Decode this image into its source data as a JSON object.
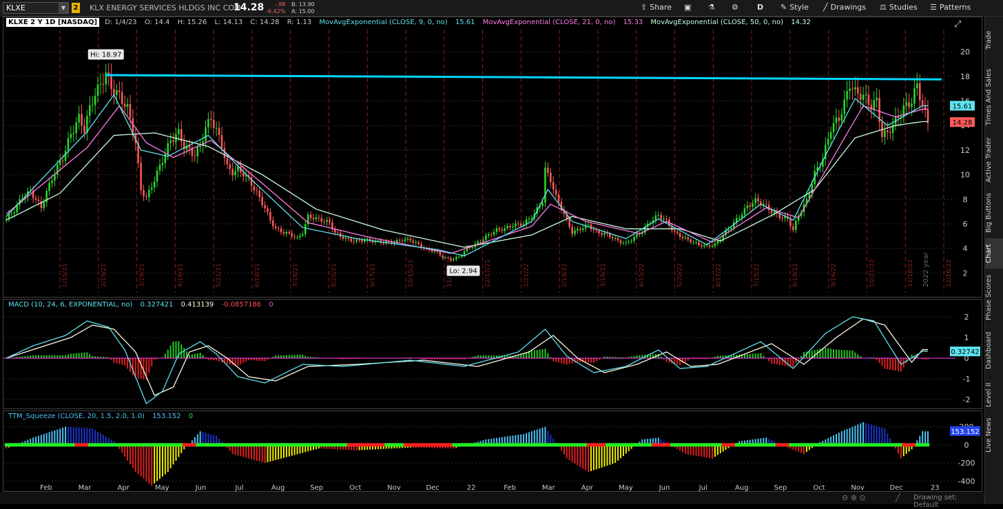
{
  "header": {
    "symbol": "KLXE",
    "link_group": "2",
    "company": "KLX ENERGY SERVICES HLDGS INC COM",
    "last": "14.28",
    "change": "-.98",
    "change_pct": "-6.42%",
    "bid": "B: 13.90",
    "ask": "A: 15.00",
    "share_label": "Share",
    "period_label": "D",
    "style_label": "Style",
    "drawings_label": "Drawings",
    "studies_label": "Studies",
    "patterns_label": "Patterns"
  },
  "price_legend": {
    "title": "KLXE 2 Y 1D [NASDAQ]",
    "date": "D: 1/4/23",
    "open": "O: 14.4",
    "high": "H: 15.26",
    "low": "L: 14.13",
    "close": "C: 14.28",
    "range": "R: 1.13",
    "ema9_label": "MovAvgExponential (CLOSE, 9, 0, no)",
    "ema9_val": "15.61",
    "ema21_label": "MovAvgExponential (CLOSE, 21, 0, no)",
    "ema21_val": "15.33",
    "ema50_label": "MovAvgExponential (CLOSE, 50, 0, no)",
    "ema50_val": "14.32"
  },
  "macd_legend": {
    "label": "MACD (10, 24, 6, EXPONENTIAL, no)",
    "value": "0.327421",
    "avg": "0.413139",
    "diff": "-0.0857186",
    "zero": "0"
  },
  "ttm_legend": {
    "label": "TTM_Squeeze (CLOSE, 20, 1.5, 2.0, 1.0)",
    "value": "153.152",
    "zero": "0"
  },
  "right_tabs": [
    "Trade",
    "Times And Sales",
    "Active Trader",
    "Big Buttons",
    "Chart",
    "Phase Scores",
    "Dashboard",
    "Level II",
    "Live News"
  ],
  "footer": {
    "drawing_set": "Drawing set: Default"
  },
  "colors": {
    "background": "#000000",
    "up_candle": "#2bd92b",
    "down_candle": "#ff5a5a",
    "ema9": "#5fe3f0",
    "ema21": "#ff7ee8",
    "ema50": "#c8ffe0",
    "resistance": "#00d8ff",
    "macd_line": "#5fe3f0",
    "macd_avg": "#fffbe0",
    "macd_zero": "#ff40ff",
    "ttm_up_strong": "#4fc3f7",
    "ttm_up_weak": "#1a33cc",
    "ttm_down_strong": "#e02020",
    "ttm_down_weak": "#f0f000",
    "squeeze_on": "#ff2020",
    "squeeze_off": "#22ee22"
  },
  "chart_data": [
    {
      "type": "candlestick",
      "title": "KLXE 2 Y 1D [NASDAQ]",
      "x_axis_months": [
        "Feb",
        "Mar",
        "Apr",
        "May",
        "Jun",
        "Jul",
        "Aug",
        "Sep",
        "Oct",
        "Nov",
        "Dec",
        "22",
        "Feb",
        "Mar",
        "Apr",
        "May",
        "Jun",
        "Jul",
        "Aug",
        "Sep",
        "Oct",
        "Nov",
        "Dec",
        "23"
      ],
      "expiration_labels": [
        "1/15/21",
        "2/19/21",
        "3/19/21",
        "4/16/21",
        "5/21/21",
        "6/18/21",
        "7/16/21",
        "8/20/21",
        "9/17/21",
        "10/15/21",
        "11/19/21",
        "12/17/21",
        "1/21/22",
        "2/18/22",
        "3/18/22",
        "4/15/22",
        "5/20/22",
        "6/17/22",
        "7/15/22",
        "8/19/22",
        "9/16/22",
        "10/21/22",
        "11/18/22",
        "12/16/22"
      ],
      "year_marker": "2022 year",
      "y_ticks": [
        2,
        4,
        6,
        8,
        10,
        12,
        14,
        16,
        18,
        20
      ],
      "y_range": [
        0.4,
        21.8
      ],
      "hi_label": "Hi: 18.97",
      "lo_label": "Lo: 2.94",
      "resistance_line": {
        "from": 18.1,
        "to": 17.75
      },
      "price_badges": {
        "ema9": "15.61",
        "last": "14.28"
      },
      "close_approx": [
        [
          0,
          6.4
        ],
        [
          3,
          7.1
        ],
        [
          6,
          8.2
        ],
        [
          9,
          8.6
        ],
        [
          11,
          8.0
        ],
        [
          13,
          7.3
        ],
        [
          15,
          8.6
        ],
        [
          18,
          10.2
        ],
        [
          21,
          11.4
        ],
        [
          24,
          13.3
        ],
        [
          27,
          14.6
        ],
        [
          29,
          13.7
        ],
        [
          31,
          15.4
        ],
        [
          33,
          16.6
        ],
        [
          35,
          17.3
        ],
        [
          37,
          18.3
        ],
        [
          39,
          17.1
        ],
        [
          42,
          16.4
        ],
        [
          45,
          15.4
        ],
        [
          48,
          12.6
        ],
        [
          50,
          8.8
        ],
        [
          52,
          8.1
        ],
        [
          55,
          9.6
        ],
        [
          58,
          11.2
        ],
        [
          61,
          12.8
        ],
        [
          64,
          13.4
        ],
        [
          66,
          12.3
        ],
        [
          68,
          12.0
        ],
        [
          70,
          11.6
        ],
        [
          72,
          12.3
        ],
        [
          74,
          13.8
        ],
        [
          76,
          14.6
        ],
        [
          78,
          13.6
        ],
        [
          80,
          12.4
        ],
        [
          82,
          10.6
        ],
        [
          84,
          10.2
        ],
        [
          86,
          10.4
        ],
        [
          88,
          10.1
        ],
        [
          90,
          9.6
        ],
        [
          93,
          8.5
        ],
        [
          96,
          7.3
        ],
        [
          98,
          6.3
        ],
        [
          100,
          5.6
        ],
        [
          103,
          5.3
        ],
        [
          106,
          5.1
        ],
        [
          108,
          4.8
        ],
        [
          110,
          5.3
        ],
        [
          112,
          6.6
        ],
        [
          114,
          6.5
        ],
        [
          117,
          6.3
        ],
        [
          120,
          6.1
        ],
        [
          122,
          5.3
        ],
        [
          124,
          5.0
        ],
        [
          127,
          4.7
        ],
        [
          130,
          4.6
        ],
        [
          133,
          4.7
        ],
        [
          136,
          4.6
        ],
        [
          140,
          4.5
        ],
        [
          144,
          4.5
        ],
        [
          147,
          4.7
        ],
        [
          150,
          4.7
        ],
        [
          153,
          4.3
        ],
        [
          156,
          3.9
        ],
        [
          159,
          3.8
        ],
        [
          162,
          3.3
        ],
        [
          165,
          3.1
        ],
        [
          168,
          3.3
        ],
        [
          171,
          4.0
        ],
        [
          173,
          4.2
        ],
        [
          176,
          4.6
        ],
        [
          179,
          5.1
        ],
        [
          182,
          5.5
        ],
        [
          185,
          5.6
        ],
        [
          188,
          5.9
        ],
        [
          192,
          6.0
        ],
        [
          196,
          6.8
        ],
        [
          199,
          7.9
        ],
        [
          200,
          10.4
        ],
        [
          202,
          9.6
        ],
        [
          204,
          8.2
        ],
        [
          206,
          7.3
        ],
        [
          208,
          6.3
        ],
        [
          210,
          5.3
        ],
        [
          213,
          5.6
        ],
        [
          216,
          5.9
        ],
        [
          219,
          5.3
        ],
        [
          222,
          5.2
        ],
        [
          225,
          4.9
        ],
        [
          227,
          4.6
        ],
        [
          230,
          4.4
        ],
        [
          233,
          4.9
        ],
        [
          236,
          5.4
        ],
        [
          239,
          6.2
        ],
        [
          242,
          6.7
        ],
        [
          245,
          6.2
        ],
        [
          248,
          5.3
        ],
        [
          251,
          4.9
        ],
        [
          254,
          4.6
        ],
        [
          257,
          4.3
        ],
        [
          260,
          4.2
        ],
        [
          263,
          4.3
        ],
        [
          266,
          5.1
        ],
        [
          269,
          5.8
        ],
        [
          272,
          6.6
        ],
        [
          275,
          7.4
        ],
        [
          278,
          7.9
        ],
        [
          281,
          7.6
        ],
        [
          284,
          7.0
        ],
        [
          287,
          6.6
        ],
        [
          290,
          6.4
        ],
        [
          292,
          5.5
        ],
        [
          294,
          6.7
        ],
        [
          297,
          7.9
        ],
        [
          300,
          10.1
        ],
        [
          303,
          11.3
        ],
        [
          306,
          13.8
        ],
        [
          309,
          14.6
        ],
        [
          311,
          15.8
        ],
        [
          313,
          17.4
        ],
        [
          315,
          16.7
        ],
        [
          318,
          16.4
        ],
        [
          321,
          15.6
        ],
        [
          323,
          16.0
        ],
        [
          325,
          13.2
        ],
        [
          327,
          13.4
        ],
        [
          330,
          14.4
        ],
        [
          333,
          15.4
        ],
        [
          336,
          16.0
        ],
        [
          338,
          17.3
        ],
        [
          340,
          15.6
        ],
        [
          342,
          14.28
        ]
      ],
      "ema9_approx": [
        [
          0,
          6.6
        ],
        [
          30,
          13.5
        ],
        [
          40,
          16.5
        ],
        [
          50,
          12.0
        ],
        [
          60,
          11.5
        ],
        [
          75,
          13.2
        ],
        [
          90,
          9.8
        ],
        [
          110,
          5.7
        ],
        [
          130,
          4.8
        ],
        [
          160,
          3.9
        ],
        [
          170,
          3.4
        ],
        [
          195,
          6.2
        ],
        [
          201,
          8.8
        ],
        [
          210,
          6.2
        ],
        [
          230,
          4.8
        ],
        [
          242,
          6.4
        ],
        [
          260,
          4.3
        ],
        [
          280,
          7.6
        ],
        [
          292,
          6.3
        ],
        [
          305,
          12.0
        ],
        [
          315,
          16.2
        ],
        [
          327,
          14.0
        ],
        [
          340,
          15.61
        ]
      ],
      "ema21_approx": [
        [
          0,
          6.8
        ],
        [
          30,
          12.2
        ],
        [
          42,
          15.6
        ],
        [
          52,
          12.6
        ],
        [
          62,
          11.4
        ],
        [
          76,
          12.8
        ],
        [
          95,
          9.3
        ],
        [
          112,
          6.1
        ],
        [
          135,
          4.9
        ],
        [
          165,
          3.6
        ],
        [
          195,
          5.8
        ],
        [
          202,
          7.6
        ],
        [
          215,
          6.2
        ],
        [
          235,
          5.2
        ],
        [
          245,
          6.2
        ],
        [
          262,
          4.5
        ],
        [
          282,
          7.3
        ],
        [
          294,
          6.5
        ],
        [
          310,
          12.6
        ],
        [
          318,
          15.6
        ],
        [
          330,
          14.7
        ],
        [
          340,
          15.33
        ]
      ],
      "ema50_approx": [
        [
          0,
          6.3
        ],
        [
          20,
          8.5
        ],
        [
          40,
          13.2
        ],
        [
          55,
          13.4
        ],
        [
          75,
          12.3
        ],
        [
          95,
          10.0
        ],
        [
          115,
          7.2
        ],
        [
          140,
          5.5
        ],
        [
          170,
          4.1
        ],
        [
          195,
          5.1
        ],
        [
          210,
          6.6
        ],
        [
          230,
          5.6
        ],
        [
          250,
          5.6
        ],
        [
          265,
          4.6
        ],
        [
          285,
          6.8
        ],
        [
          300,
          8.8
        ],
        [
          315,
          13.0
        ],
        [
          330,
          14.0
        ],
        [
          340,
          14.32
        ]
      ]
    },
    {
      "type": "line",
      "title": "MACD (10, 24, 6, EXPONENTIAL, no)",
      "y_ticks": [
        -2,
        -1,
        0,
        1,
        2
      ],
      "y_range": [
        -2.3,
        2.3
      ],
      "value_badge": "0.32742",
      "macd_approx": [
        [
          0,
          0
        ],
        [
          10,
          0.6
        ],
        [
          22,
          1.1
        ],
        [
          30,
          1.8
        ],
        [
          38,
          1.5
        ],
        [
          44,
          0.4
        ],
        [
          52,
          -2.2
        ],
        [
          58,
          -1.6
        ],
        [
          64,
          0.2
        ],
        [
          72,
          0.8
        ],
        [
          78,
          0.2
        ],
        [
          86,
          -0.9
        ],
        [
          96,
          -1.2
        ],
        [
          110,
          -0.3
        ],
        [
          125,
          -0.4
        ],
        [
          150,
          -0.1
        ],
        [
          170,
          -0.4
        ],
        [
          190,
          0.3
        ],
        [
          200,
          1.4
        ],
        [
          208,
          0.1
        ],
        [
          218,
          -0.7
        ],
        [
          230,
          -0.4
        ],
        [
          242,
          0.4
        ],
        [
          250,
          -0.5
        ],
        [
          260,
          -0.4
        ],
        [
          280,
          0.8
        ],
        [
          292,
          -0.5
        ],
        [
          304,
          1.2
        ],
        [
          314,
          2.0
        ],
        [
          322,
          1.8
        ],
        [
          332,
          -0.3
        ],
        [
          340,
          0.33
        ]
      ],
      "avg_approx": [
        [
          0,
          0
        ],
        [
          12,
          0.5
        ],
        [
          24,
          1.0
        ],
        [
          32,
          1.6
        ],
        [
          40,
          1.4
        ],
        [
          48,
          0.3
        ],
        [
          55,
          -1.8
        ],
        [
          62,
          -1.4
        ],
        [
          68,
          0.3
        ],
        [
          75,
          0.6
        ],
        [
          82,
          0.0
        ],
        [
          90,
          -0.9
        ],
        [
          100,
          -1.1
        ],
        [
          112,
          -0.4
        ],
        [
          130,
          -0.3
        ],
        [
          155,
          -0.1
        ],
        [
          175,
          -0.4
        ],
        [
          194,
          0.3
        ],
        [
          203,
          1.1
        ],
        [
          212,
          0.0
        ],
        [
          222,
          -0.7
        ],
        [
          234,
          -0.3
        ],
        [
          245,
          0.3
        ],
        [
          254,
          -0.4
        ],
        [
          264,
          -0.3
        ],
        [
          284,
          0.7
        ],
        [
          296,
          -0.3
        ],
        [
          308,
          1.0
        ],
        [
          318,
          1.9
        ],
        [
          326,
          1.6
        ],
        [
          336,
          -0.2
        ],
        [
          340,
          0.41
        ]
      ]
    },
    {
      "type": "bar",
      "title": "TTM_Squeeze (CLOSE, 20, 1.5, 2.0, 1.0)",
      "y_ticks": [
        -400,
        -200,
        0,
        200
      ],
      "y_range": [
        -480,
        250
      ],
      "value_badge": "153.152",
      "histogram_approx": [
        [
          0,
          -40
        ],
        [
          10,
          80
        ],
        [
          22,
          200
        ],
        [
          32,
          180
        ],
        [
          40,
          40
        ],
        [
          48,
          -300
        ],
        [
          54,
          -450
        ],
        [
          60,
          -300
        ],
        [
          66,
          -50
        ],
        [
          72,
          150
        ],
        [
          78,
          100
        ],
        [
          84,
          -100
        ],
        [
          96,
          -200
        ],
        [
          106,
          -120
        ],
        [
          116,
          -40
        ],
        [
          130,
          -60
        ],
        [
          150,
          -30
        ],
        [
          166,
          -40
        ],
        [
          178,
          60
        ],
        [
          192,
          120
        ],
        [
          200,
          200
        ],
        [
          208,
          -150
        ],
        [
          216,
          -300
        ],
        [
          226,
          -200
        ],
        [
          236,
          60
        ],
        [
          242,
          80
        ],
        [
          252,
          -100
        ],
        [
          262,
          -150
        ],
        [
          272,
          40
        ],
        [
          282,
          80
        ],
        [
          290,
          -30
        ],
        [
          296,
          -100
        ],
        [
          302,
          30
        ],
        [
          310,
          150
        ],
        [
          318,
          250
        ],
        [
          326,
          180
        ],
        [
          332,
          -150
        ],
        [
          336,
          -50
        ],
        [
          340,
          150
        ]
      ],
      "squeeze_on_ranges": [
        [
          26,
          30
        ],
        [
          66,
          70
        ],
        [
          127,
          140
        ],
        [
          148,
          165
        ],
        [
          216,
          222
        ],
        [
          240,
          246
        ],
        [
          266,
          270
        ],
        [
          286,
          290
        ],
        [
          333,
          337
        ]
      ]
    }
  ]
}
